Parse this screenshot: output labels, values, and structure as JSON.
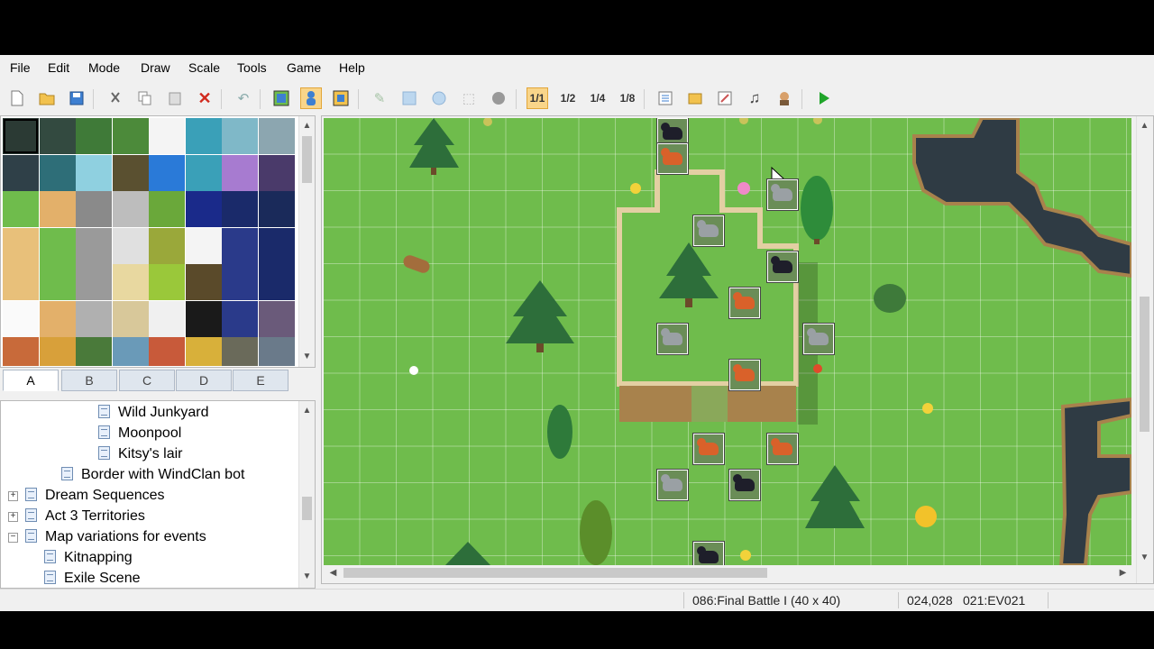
{
  "menu": [
    "File",
    "Edit",
    "Mode",
    "Draw",
    "Scale",
    "Tools",
    "Game",
    "Help"
  ],
  "toolbar": {
    "icons": [
      "new-project-icon",
      "open-project-icon",
      "save-project-icon",
      "cut-icon",
      "copy-icon",
      "paste-icon",
      "delete-icon",
      "undo-icon",
      "layer-map-icon",
      "layer-event-icon",
      "region-icon",
      "pencil-icon",
      "rectangle-icon",
      "ellipse-icon",
      "fill-icon",
      "shadow-pen-icon"
    ],
    "scale": [
      "1/1",
      "1/2",
      "1/4",
      "1/8"
    ],
    "playtest_icon": "play-icon"
  },
  "tile_tabs": [
    "A",
    "B",
    "C",
    "D",
    "E"
  ],
  "tree": {
    "items": [
      {
        "label": "Wild Junkyard",
        "indent": 3,
        "expander": null
      },
      {
        "label": "Moonpool",
        "indent": 3,
        "expander": null
      },
      {
        "label": "Kitsy's lair",
        "indent": 3,
        "expander": null
      },
      {
        "label": "Border with WindClan bot",
        "indent": 2,
        "expander": null
      },
      {
        "label": "Dream Sequences",
        "indent": 1,
        "expander": "+"
      },
      {
        "label": "Act 3 Territories",
        "indent": 1,
        "expander": "+"
      },
      {
        "label": "Map variations for events",
        "indent": 1,
        "expander": "−"
      },
      {
        "label": "Kitnapping",
        "indent": 2,
        "expander": null
      },
      {
        "label": "Exile Scene",
        "indent": 2,
        "expander": null
      }
    ]
  },
  "status": {
    "map": "086:Final Battle I (40 x 40)",
    "coords": "024,028",
    "event": "021:EV021"
  },
  "colors": {
    "grass": "#6fbc4c",
    "rock": "#2f3b44",
    "cliff": "#a8824c",
    "cat_orange": "#d9612a",
    "cat_black": "#1e1e2a",
    "cat_gray": "#9aa0a4"
  }
}
